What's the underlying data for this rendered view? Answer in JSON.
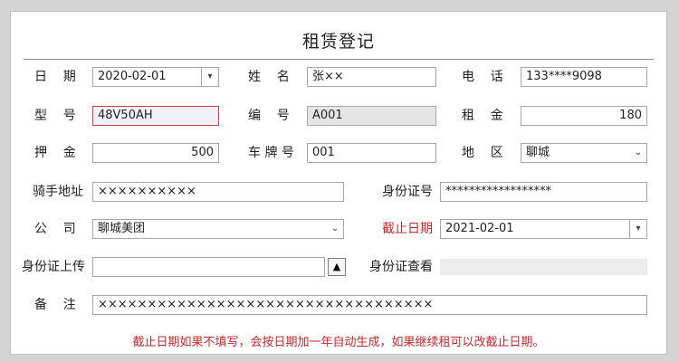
{
  "title": "租赁登记",
  "fields": {
    "date": {
      "label": "日    期",
      "value": "2020-02-01"
    },
    "name": {
      "label": "姓    名",
      "value": "张××"
    },
    "phone": {
      "label": "电    话",
      "value": "133****9098"
    },
    "model": {
      "label": "型    号",
      "value": "48V50AH"
    },
    "code": {
      "label": "编    号",
      "value": "A001"
    },
    "rent": {
      "label": "租    金",
      "value": "180"
    },
    "deposit": {
      "label": "押    金",
      "value": "500"
    },
    "plate": {
      "label": "车 牌 号",
      "value": "001"
    },
    "region": {
      "label": "地    区",
      "value": "聊城"
    },
    "address": {
      "label": "骑手地址",
      "value": "××××××××××"
    },
    "id_number": {
      "label": "身份证号",
      "value": "******************"
    },
    "company": {
      "label": "公    司",
      "value": "聊城美团"
    },
    "deadline": {
      "label": "截止日期",
      "value": "2021-02-01"
    },
    "id_upload": {
      "label": "身份证上传",
      "value": ""
    },
    "id_view": {
      "label": "身份证查看",
      "value": ""
    },
    "remark": {
      "label": "备    注",
      "value": "××××××××××××××××××××××××××××××××××"
    }
  },
  "icons": {
    "dropdown": "chevron-down-icon",
    "upload": "triangle-up-icon"
  },
  "note": "截止日期如果不填写，会按日期加一年自动生成，如果继续租可以改截止日期。",
  "colors": {
    "accent_red": "#c8282d",
    "readonly_gray": "#e4e4e4"
  }
}
